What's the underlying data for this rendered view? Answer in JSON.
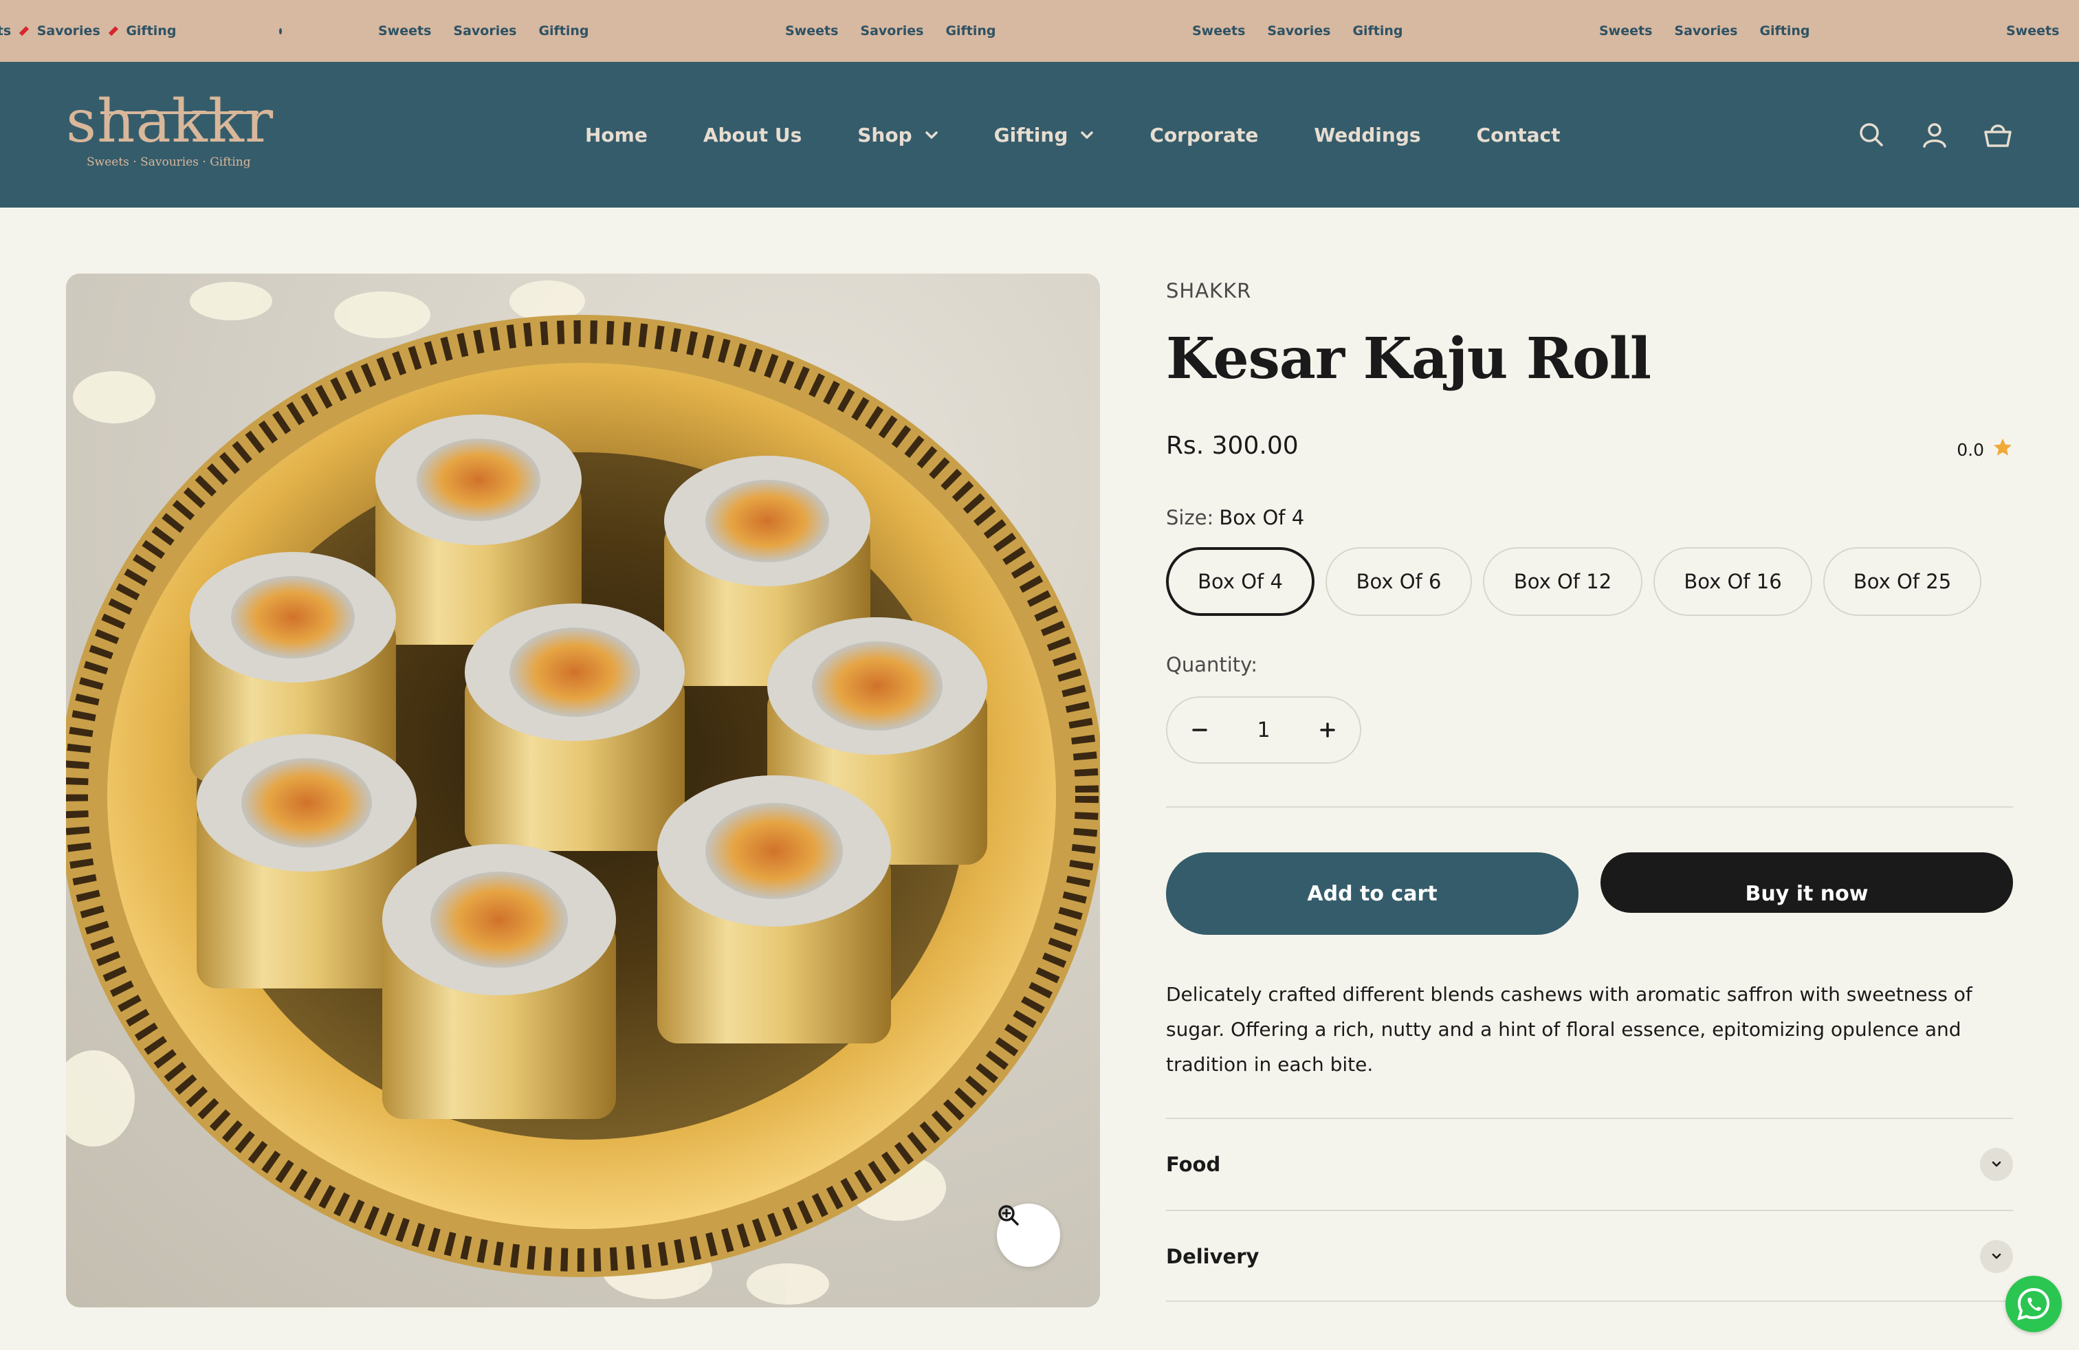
{
  "announcement": {
    "word_1": "Sweets",
    "word_2": "Savories",
    "word_3": "Gifting",
    "first_partial": "eets"
  },
  "header": {
    "logo_text": "shakkr",
    "logo_tagline": "Sweets · Savouries · Gifting",
    "nav": {
      "home": "Home",
      "about": "About Us",
      "shop": "Shop",
      "gifting": "Gifting",
      "corporate": "Corporate",
      "weddings": "Weddings",
      "contact": "Contact"
    }
  },
  "product": {
    "vendor": "SHAKKR",
    "title": "Kesar Kaju Roll",
    "price": "Rs. 300.00",
    "rating_value": "0.0",
    "size_label": "Size:",
    "size_selected": "Box Of 4",
    "sizes": [
      "Box Of 4",
      "Box Of 6",
      "Box Of 12",
      "Box Of 16",
      "Box Of 25"
    ],
    "quantity_label": "Quantity:",
    "quantity_value": "1",
    "add_to_cart": "Add to cart",
    "buy_now": "Buy it now",
    "description": "Delicately crafted different blends cashews with aromatic saffron with sweetness of sugar. Offering a rich, nutty and a hint of floral essence, epitomizing opulence and tradition in each bite.",
    "accordions": [
      "Food",
      "Delivery"
    ]
  },
  "colors": {
    "header_bg": "#355c6b",
    "marquee_bg": "#d7b8a0",
    "page_bg": "#f5f4ec",
    "accent_red": "#d8252d",
    "star": "#f0a93b"
  },
  "icons": {
    "search": "search-icon",
    "account": "user-icon",
    "cart": "basket-icon",
    "zoom": "zoom-in-icon",
    "whatsapp": "whatsapp-icon"
  }
}
